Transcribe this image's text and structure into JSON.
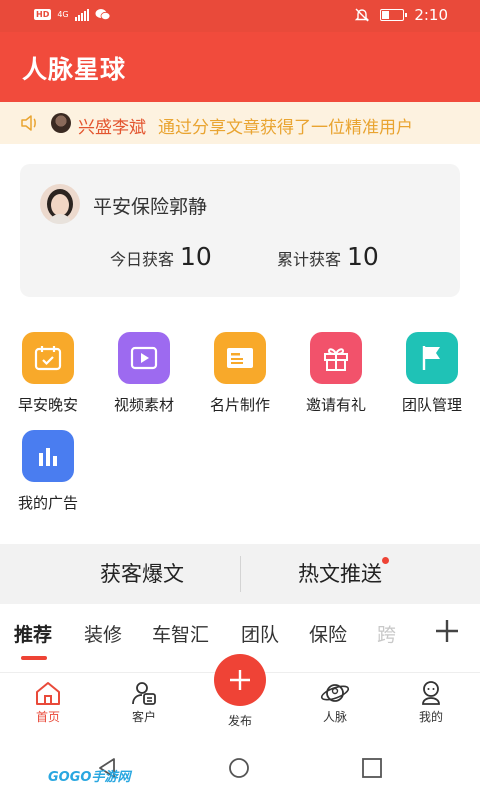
{
  "status_bar": {
    "hd": "HD",
    "network": "4G",
    "time": "2:10",
    "battery_level": 0.3
  },
  "app": {
    "title": "人脉星球"
  },
  "notice": {
    "name": "兴盛李斌",
    "message": "通过分享文章获得了一位精准用户"
  },
  "profile_card": {
    "user_name": "平安保险郭静",
    "today_label": "今日获客",
    "today_value": "10",
    "total_label": "累计获客",
    "total_value": "10"
  },
  "features": [
    {
      "label": "早安晚安",
      "icon": "calendar-icon",
      "color": "#f8a92a"
    },
    {
      "label": "视频素材",
      "icon": "video-play-icon",
      "color": "#9d6af0"
    },
    {
      "label": "名片制作",
      "icon": "business-card-icon",
      "color": "#f8a92a"
    },
    {
      "label": "邀请有礼",
      "icon": "gift-icon",
      "color": "#f2526b"
    },
    {
      "label": "团队管理",
      "icon": "flag-icon",
      "color": "#1fc2b6"
    },
    {
      "label": "我的广告",
      "icon": "bar-chart-icon",
      "color": "#4a7df0"
    }
  ],
  "segments": {
    "left": "获客爆文",
    "right": "热文推送"
  },
  "tabs": [
    "推荐",
    "装修",
    "车智汇",
    "团队",
    "保险",
    "跨"
  ],
  "bottom_nav": {
    "home": "首页",
    "customers": "客户",
    "publish": "发布",
    "network": "人脉",
    "me": "我的"
  },
  "watermark": "GOGO手游网",
  "colors": {
    "brand": "#f14b3c",
    "notice_name": "#e3552f",
    "notice_msg": "#e9a431"
  }
}
